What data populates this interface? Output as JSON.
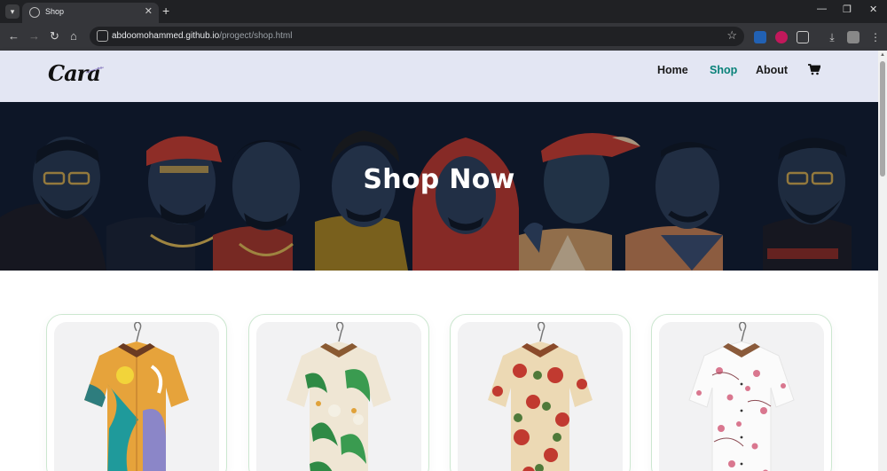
{
  "browser": {
    "tab_title": "Shop",
    "url_host": "abdoomohammed.github.io",
    "url_path": "/progect/shop.html"
  },
  "site": {
    "logo_text": "Cara",
    "nav": [
      {
        "label": "Home",
        "active": false
      },
      {
        "label": "Shop",
        "active": true
      },
      {
        "label": "About",
        "active": false
      }
    ],
    "accent_color": "#088178",
    "header_bg": "#e3e6f3"
  },
  "hero": {
    "title": "Shop Now"
  },
  "products": [
    {
      "image": "colorful-abstract-print-shirt"
    },
    {
      "image": "tropical-leaf-print-shirt"
    },
    {
      "image": "floral-red-print-shirt"
    },
    {
      "image": "white-pink-floral-shirt"
    }
  ]
}
